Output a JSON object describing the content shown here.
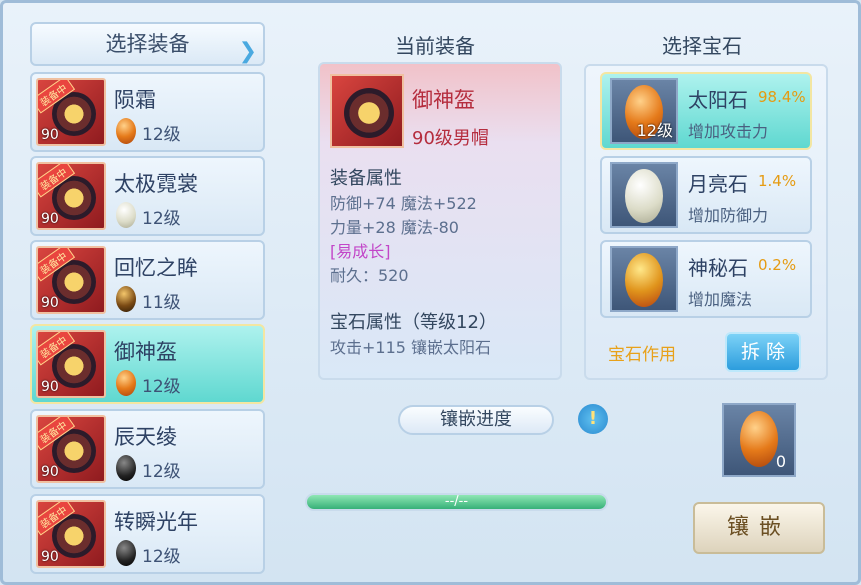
{
  "left": {
    "header": "选择装备",
    "items": [
      {
        "name": "陨霜",
        "level": "90",
        "tag": "装备中",
        "gem_level": "12级",
        "gem_icon": "orange-gem-icon"
      },
      {
        "name": "太极霓裳",
        "level": "90",
        "tag": "装备中",
        "gem_level": "12级",
        "gem_icon": "white-gem-icon"
      },
      {
        "name": "回忆之眸",
        "level": "90",
        "tag": "装备中",
        "gem_level": "11级",
        "gem_icon": "mixed-gem-icon"
      },
      {
        "name": "御神盔",
        "level": "90",
        "tag": "装备中",
        "gem_level": "12级",
        "gem_icon": "orange-gem-icon"
      },
      {
        "name": "辰天绫",
        "level": "90",
        "tag": "装备中",
        "gem_level": "12级",
        "gem_icon": "dark-gem-icon"
      },
      {
        "name": "转瞬光年",
        "level": "90",
        "tag": "装备中",
        "gem_level": "12级",
        "gem_icon": "dark-gem-icon"
      }
    ]
  },
  "center": {
    "title": "当前装备",
    "name": "御神盔",
    "subtitle": "90级男帽",
    "attr_header": "装备属性",
    "attr1": "防御+74 魔法+522",
    "attr2": "力量+28 魔法-80",
    "trait": "[易成长]",
    "durability": "耐久：520",
    "gem_header": "宝石属性（等级12）",
    "gem_attr": "攻击+115 镶嵌太阳石",
    "progress_label": "镶嵌进度",
    "progress_text": "--/--"
  },
  "right": {
    "title": "选择宝石",
    "gems": [
      {
        "name": "太阳石",
        "pct": "98.4%",
        "desc": "增加攻击力",
        "level": "12级"
      },
      {
        "name": "月亮石",
        "pct": "1.4%",
        "desc": "增加防御力",
        "level": ""
      },
      {
        "name": "神秘石",
        "pct": "0.2%",
        "desc": "增加魔法",
        "level": ""
      }
    ],
    "effect_label": "宝石作用",
    "remove_label": "拆 除",
    "slot_count": "0",
    "inlay_label": "镶嵌"
  },
  "colors": {
    "selected": "#5fd8d0",
    "accent": "#2d9ddd",
    "equip_red": "#b52d3e"
  }
}
